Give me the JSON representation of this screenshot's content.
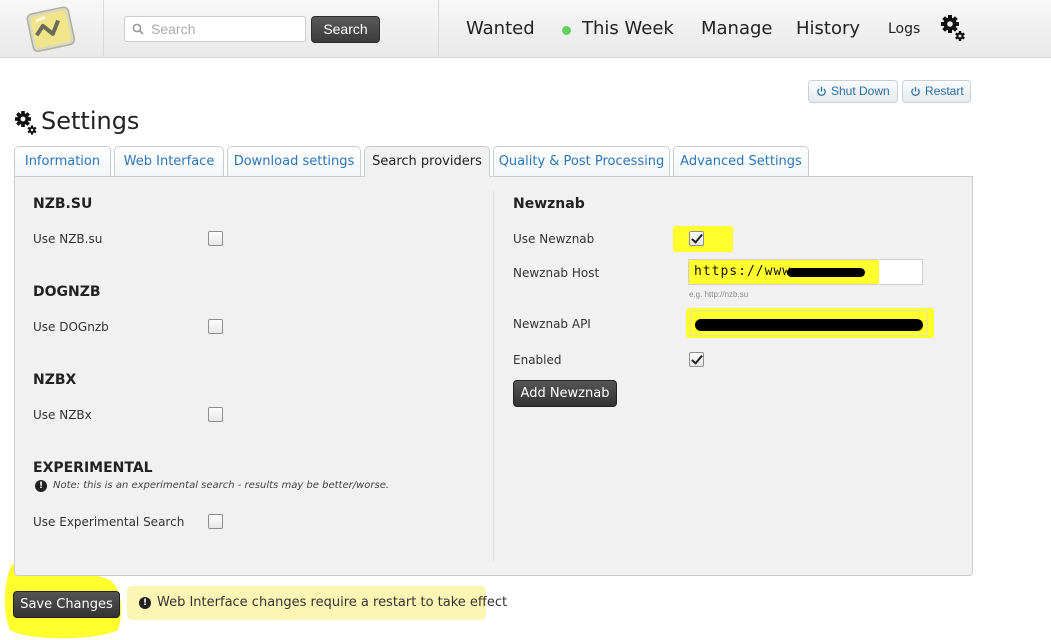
{
  "search": {
    "placeholder": "Search",
    "button_label": "Search"
  },
  "nav": {
    "items": [
      {
        "label": "Wanted"
      },
      {
        "label": "This Week",
        "status_dot_color": "#5fd15a"
      },
      {
        "label": "Manage"
      },
      {
        "label": "History"
      },
      {
        "label": "Logs"
      }
    ],
    "settings_icon": "gear-icon"
  },
  "system_buttons": {
    "shutdown_label": "Shut Down",
    "restart_label": "Restart"
  },
  "page": {
    "title": "Settings"
  },
  "tabs": [
    {
      "label": "Information",
      "active": false
    },
    {
      "label": "Web Interface",
      "active": false
    },
    {
      "label": "Download settings",
      "active": false
    },
    {
      "label": "Search providers",
      "active": true
    },
    {
      "label": "Quality & Post Processing",
      "active": false
    },
    {
      "label": "Advanced Settings",
      "active": false
    }
  ],
  "providers_left": {
    "nzbsu": {
      "title": "NZB.SU",
      "label": "Use NZB.su",
      "checked": false
    },
    "dognzb": {
      "title": "DOGNZB",
      "label": "Use DOGnzb",
      "checked": false
    },
    "nzbx": {
      "title": "NZBX",
      "label": "Use NZBx",
      "checked": false
    },
    "experimental": {
      "title": "EXPERIMENTAL",
      "note": "Note: this is an experimental search - results may be better/worse.",
      "label": "Use Experimental Search",
      "checked": false
    }
  },
  "newznab": {
    "title": "Newznab",
    "use_label": "Use Newznab",
    "use_checked": true,
    "host_label": "Newznab Host",
    "host_value": "https://www.",
    "host_hint": "e.g. http://nzb.su",
    "api_label": "Newznab API",
    "enabled_label": "Enabled",
    "enabled_checked": true,
    "add_button_label": "Add Newznab"
  },
  "footer": {
    "save_label": "Save Changes",
    "notice": "Web Interface changes require a restart to take effect"
  },
  "colors": {
    "highlight": "#ffff2e",
    "accent_link": "#2b76b9",
    "notice_bg": "#fcf6b4"
  }
}
